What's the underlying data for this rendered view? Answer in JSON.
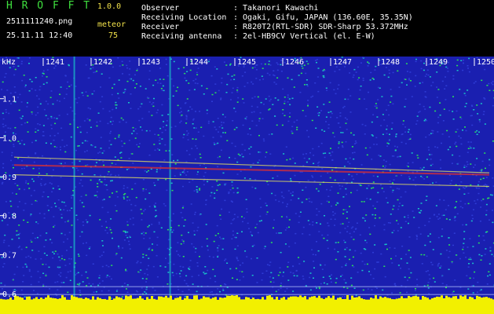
{
  "app": {
    "name": "H R O F F T",
    "version": "1.0.0",
    "filename": "2511111240.png",
    "datetime": "25.11.11 12:40",
    "count_label": "meteor",
    "count_value": "75"
  },
  "info": {
    "observer_label": "Observer",
    "observer_value": ": Takanori Kawachi",
    "location_label": "Receiving Location",
    "location_value": ": Ogaki, Gifu, JAPAN (136.60E, 35.35N)",
    "receiver_label": "Receiver",
    "receiver_value": ": R820T2(RTL-SDR) SDR-Sharp 53.372MHz",
    "antenna_label": "Receiving antenna",
    "antenna_value": ": 2el-HB9CV Vertical (el. E-W)"
  },
  "chart_data": {
    "type": "heatmap",
    "x_unit": "",
    "y_unit": "kHz",
    "x_ticks": [
      "1241",
      "1242",
      "1243",
      "1244",
      "1245",
      "1246",
      "1247",
      "1248",
      "1249",
      "1250"
    ],
    "y_ticks": [
      "1.1",
      "1.0",
      "0.9",
      "0.8",
      "0.7",
      "0.6"
    ],
    "y_tick_values": [
      1.1,
      1.0,
      0.9,
      0.8,
      0.7,
      0.6
    ],
    "ylim": [
      0.58,
      1.18
    ],
    "colors": {
      "background": "#1a1fb0",
      "noise_low": "#2e3cd6",
      "noise_mid": "#19c0c8",
      "noise_high": "#2ae05a",
      "echo": "#e6e060",
      "hot": "#e03030",
      "bottom_bar": "#f2f000",
      "tick_text": "#ffffff"
    },
    "traces": [
      {
        "name": "",
        "y_start": 0.93,
        "y_end": 0.905
      },
      {
        "name": "",
        "y_start": 0.95,
        "y_end": 0.91
      },
      {
        "name": "",
        "y_start": 0.905,
        "y_end": 0.875
      }
    ],
    "vertical_lines_at": [
      "1242",
      "1244"
    ]
  }
}
